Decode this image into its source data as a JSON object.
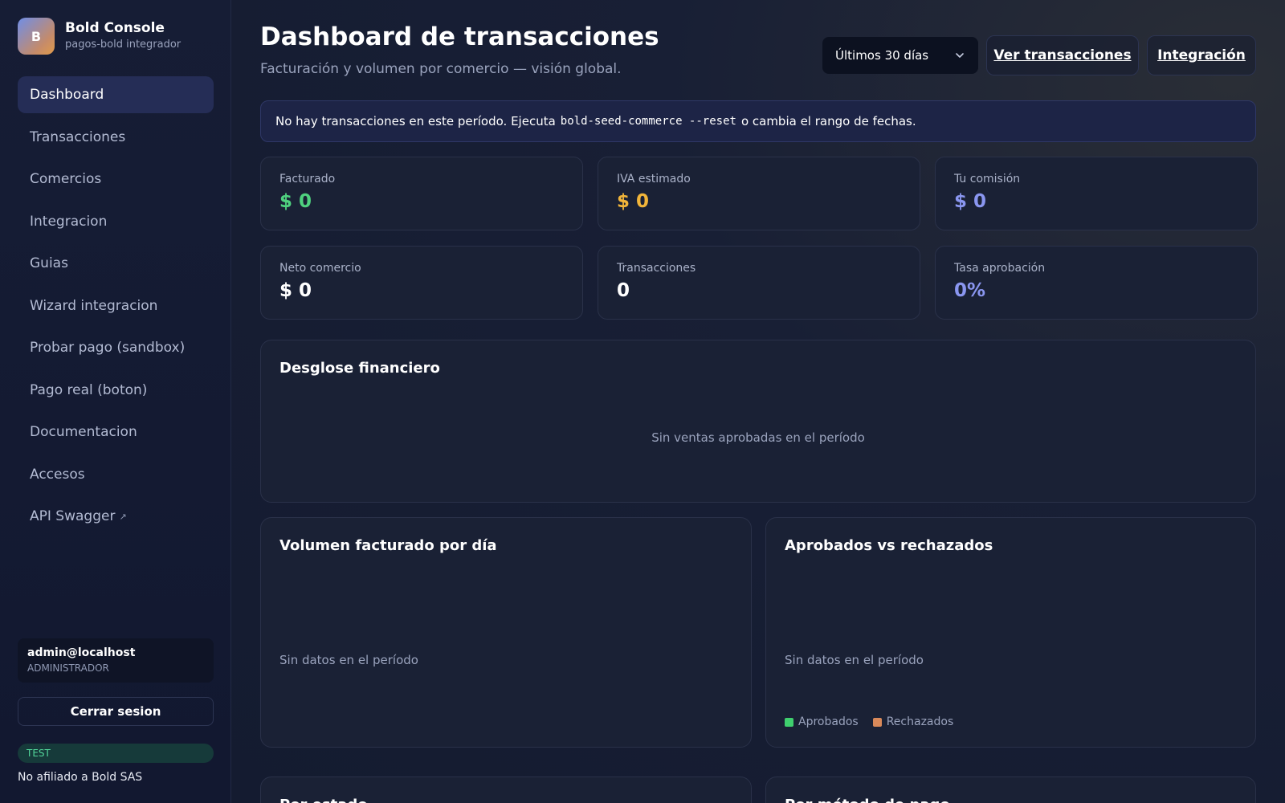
{
  "brand": {
    "logo_letter": "B",
    "title": "Bold Console",
    "subtitle": "pagos-bold integrador"
  },
  "sidebar": {
    "items": [
      {
        "label": "Dashboard",
        "active": true
      },
      {
        "label": "Transacciones"
      },
      {
        "label": "Comercios"
      },
      {
        "label": "Integracion"
      },
      {
        "label": "Guias"
      },
      {
        "label": "Wizard integracion"
      },
      {
        "label": "Probar pago (sandbox)"
      },
      {
        "label": "Pago real (boton)"
      },
      {
        "label": "Documentacion"
      },
      {
        "label": "Accesos"
      },
      {
        "label": "API Swagger",
        "icon": "external-link-icon"
      }
    ],
    "external_glyph": "↗"
  },
  "user": {
    "email": "admin@localhost",
    "role": "ADMINISTRADOR"
  },
  "logout_label": "Cerrar sesion",
  "env_badge": "TEST",
  "disclaimer": "No afiliado a Bold SAS",
  "header": {
    "title": "Dashboard de transacciones",
    "subtitle": "Facturación y volumen por comercio — visión global.",
    "range": {
      "selected": "Últimos 30 días",
      "icon": "chevron-down-icon"
    },
    "view_transactions_label": "Ver transacciones",
    "integration_label": "Integración"
  },
  "notice": {
    "before": "No hay transacciones en este período. Ejecuta",
    "command": "bold-seed-commerce --reset",
    "after": "o cambia el rango de fechas."
  },
  "kpis": [
    {
      "label": "Facturado",
      "value": "$ 0",
      "color": "#4fd17f"
    },
    {
      "label": "IVA estimado",
      "value": "$ 0",
      "color": "#f2b53a"
    },
    {
      "label": "Tu comisión",
      "value": "$ 0",
      "color": "#8a96f0"
    },
    {
      "label": "Neto comercio",
      "value": "$ 0",
      "color": "#ffffff"
    },
    {
      "label": "Transacciones",
      "value": "0",
      "color": "#ffffff"
    },
    {
      "label": "Tasa aprobación",
      "value": "0%",
      "color": "#8a96f0"
    }
  ],
  "panels": {
    "financial": {
      "title": "Desglose financiero",
      "empty": "Sin ventas aprobadas en el período"
    },
    "volume": {
      "title": "Volumen facturado por día",
      "empty": "Sin datos en el período"
    },
    "approved": {
      "title": "Aprobados vs rechazados",
      "empty": "Sin datos en el período",
      "legend": [
        {
          "label": "Aprobados",
          "color": "#3fcf6e"
        },
        {
          "label": "Rechazados",
          "color": "#d9895a"
        }
      ]
    },
    "by_status": {
      "title": "Por estado"
    },
    "by_method": {
      "title": "Por método de pago"
    }
  }
}
